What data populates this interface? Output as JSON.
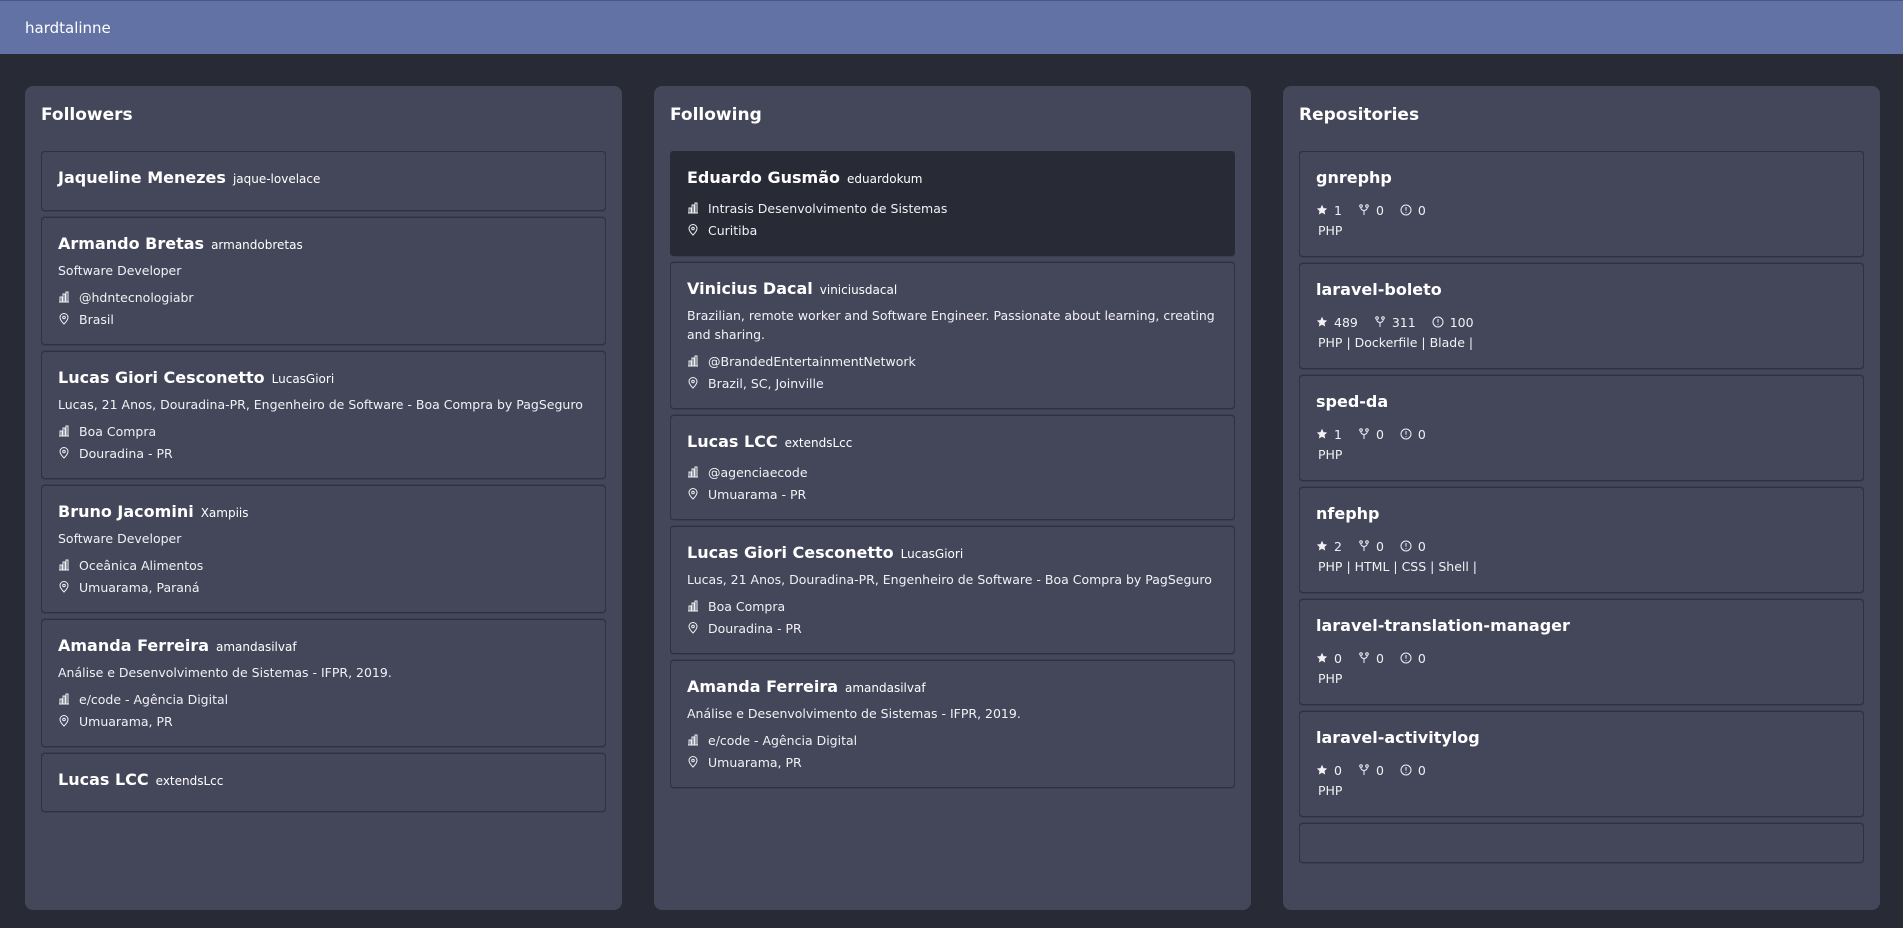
{
  "header": {
    "username": "hardtalinne"
  },
  "followers": {
    "title": "Followers",
    "items": [
      {
        "name": "Jaqueline Menezes",
        "login": "jaque-lovelace",
        "bio": "",
        "company": "",
        "location": ""
      },
      {
        "name": "Armando Bretas",
        "login": "armandobretas",
        "bio": "Software Developer",
        "company": "@hdntecnologiabr",
        "location": "Brasil"
      },
      {
        "name": "Lucas Giori Cesconetto",
        "login": "LucasGiori",
        "bio": "Lucas, 21 Anos, Douradina-PR, Engenheiro de Software - Boa Compra by PagSeguro",
        "company": "Boa Compra",
        "location": "Douradina - PR"
      },
      {
        "name": "Bruno Jacomini",
        "login": "Xampiis",
        "bio": "Software Developer",
        "company": "Oceânica Alimentos",
        "location": "Umuarama, Paraná"
      },
      {
        "name": "Amanda Ferreira",
        "login": "amandasilvaf",
        "bio": "Análise e Desenvolvimento de Sistemas - IFPR, 2019.",
        "company": "e/code - Agência Digital",
        "location": "Umuarama, PR"
      },
      {
        "name": "Lucas LCC",
        "login": "extendsLcc",
        "bio": "",
        "company": "",
        "location": ""
      }
    ]
  },
  "following": {
    "title": "Following",
    "items": [
      {
        "name": "Eduardo Gusmão",
        "login": "eduardokum",
        "bio": "",
        "company": "Intrasis Desenvolvimento de Sistemas",
        "location": "Curitiba"
      },
      {
        "name": "Vinicius Dacal",
        "login": "viniciusdacal",
        "bio": "Brazilian, remote worker and Software Engineer. Passionate about learning, creating and sharing.",
        "company": "@BrandedEntertainmentNetwork",
        "location": "Brazil, SC, Joinville"
      },
      {
        "name": "Lucas LCC",
        "login": "extendsLcc",
        "bio": "",
        "company": "@agenciaecode",
        "location": "Umuarama - PR"
      },
      {
        "name": "Lucas Giori Cesconetto",
        "login": "LucasGiori",
        "bio": "Lucas, 21 Anos, Douradina-PR, Engenheiro de Software - Boa Compra by PagSeguro",
        "company": "Boa Compra",
        "location": "Douradina - PR"
      },
      {
        "name": "Amanda Ferreira",
        "login": "amandasilvaf",
        "bio": "Análise e Desenvolvimento de Sistemas - IFPR, 2019.",
        "company": "e/code - Agência Digital",
        "location": "Umuarama, PR"
      }
    ]
  },
  "repositories": {
    "title": "Repositories",
    "items": [
      {
        "name": "gnrephp",
        "stars": "1",
        "forks": "0",
        "issues": "0",
        "languages": "PHP"
      },
      {
        "name": "laravel-boleto",
        "stars": "489",
        "forks": "311",
        "issues": "100",
        "languages": "PHP | Dockerfile | Blade |"
      },
      {
        "name": "sped-da",
        "stars": "1",
        "forks": "0",
        "issues": "0",
        "languages": "PHP"
      },
      {
        "name": "nfephp",
        "stars": "2",
        "forks": "0",
        "issues": "0",
        "languages": "PHP | HTML | CSS | Shell |"
      },
      {
        "name": "laravel-translation-manager",
        "stars": "0",
        "forks": "0",
        "issues": "0",
        "languages": "PHP"
      },
      {
        "name": "laravel-activitylog",
        "stars": "0",
        "forks": "0",
        "issues": "0",
        "languages": "PHP"
      }
    ]
  },
  "icons": {
    "company": "building-icon",
    "location": "map-pin-icon",
    "star": "star-icon",
    "fork": "fork-icon",
    "issues": "issue-icon"
  },
  "colors": {
    "header_bg": "#6272a4",
    "page_bg": "#282a36",
    "panel_bg": "#44475a",
    "highlight_card_bg": "#282a36"
  }
}
